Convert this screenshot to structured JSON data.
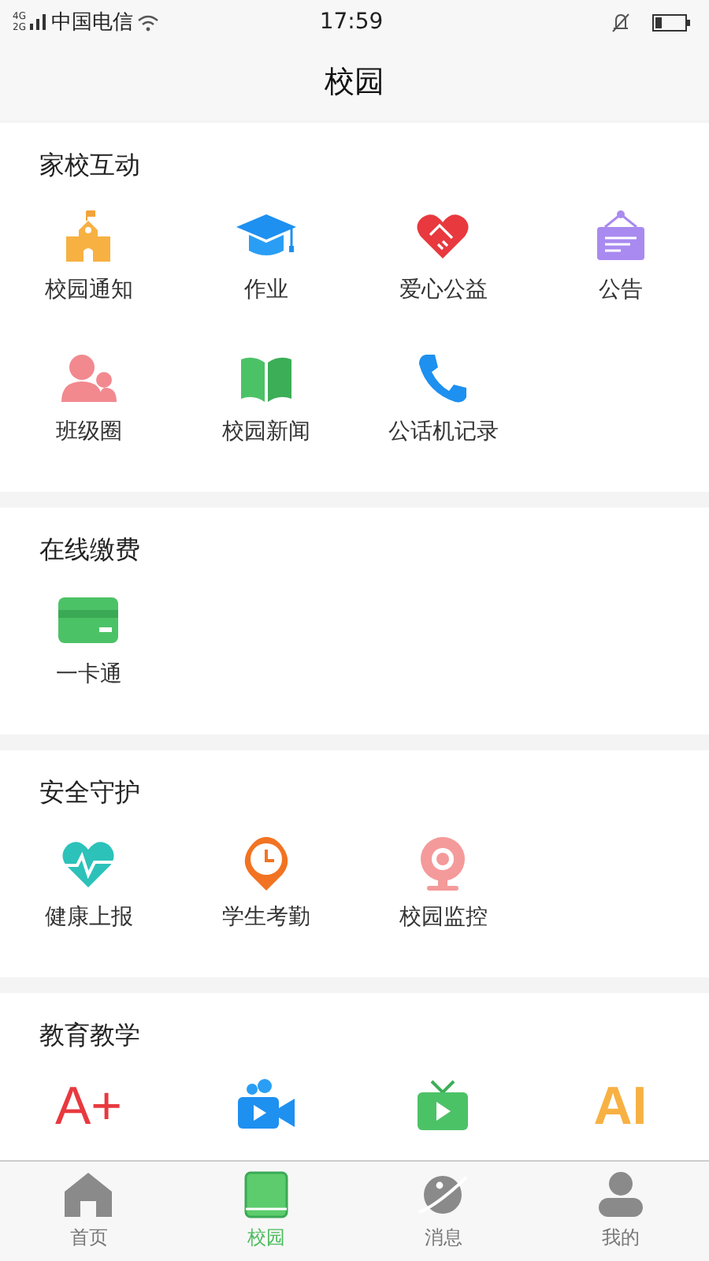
{
  "status_bar": {
    "network": [
      "4G",
      "2G"
    ],
    "carrier": "中国电信",
    "time": "17:59"
  },
  "title": "校园",
  "sections": [
    {
      "title": "家校互动",
      "items": [
        {
          "label": "校园通知",
          "kind": "school"
        },
        {
          "label": "作业",
          "kind": "cap"
        },
        {
          "label": "爱心公益",
          "kind": "heart"
        },
        {
          "label": "公告",
          "kind": "board"
        },
        {
          "label": "班级圈",
          "kind": "people"
        },
        {
          "label": "校园新闻",
          "kind": "book"
        },
        {
          "label": "公话机记录",
          "kind": "phone"
        }
      ]
    },
    {
      "title": "在线缴费",
      "items": [
        {
          "label": "一卡通",
          "kind": "card"
        }
      ]
    },
    {
      "title": "安全守护",
      "items": [
        {
          "label": "健康上报",
          "kind": "pulse"
        },
        {
          "label": "学生考勤",
          "kind": "clock"
        },
        {
          "label": "校园监控",
          "kind": "camera"
        }
      ]
    },
    {
      "title": "教育教学",
      "items": [
        {
          "kind": "grade",
          "icon_text": "A+"
        },
        {
          "kind": "video"
        },
        {
          "kind": "tv"
        },
        {
          "kind": "ai",
          "icon_text": "AI"
        }
      ]
    }
  ],
  "tabs": [
    {
      "label": "首页",
      "kind": "home",
      "selected": false
    },
    {
      "label": "校园",
      "kind": "book",
      "selected": true
    },
    {
      "label": "消息",
      "kind": "planet",
      "selected": false
    },
    {
      "label": "我的",
      "kind": "person",
      "selected": false
    }
  ]
}
